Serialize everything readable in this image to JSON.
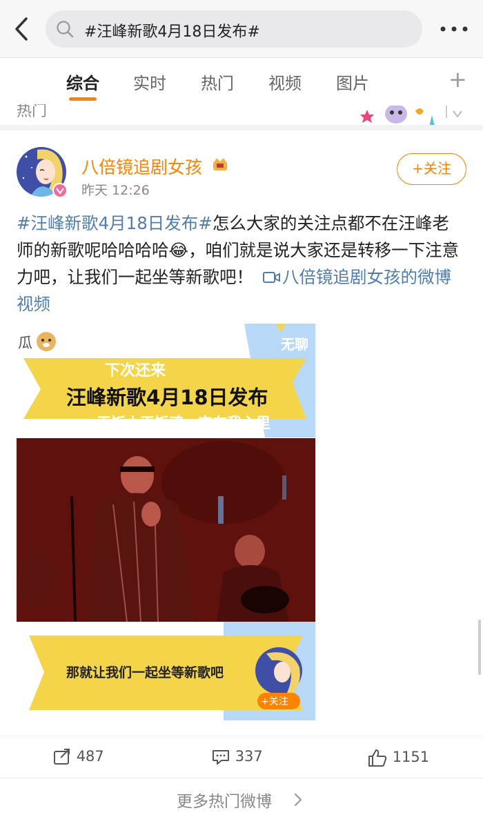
{
  "search": {
    "query": "#汪峰新歌4月18日发布#"
  },
  "tabs": [
    {
      "label": "综合"
    },
    {
      "label": "实时"
    },
    {
      "label": "热门"
    },
    {
      "label": "视频"
    },
    {
      "label": "图片"
    }
  ],
  "strip": {
    "label": "热门"
  },
  "post": {
    "author": "八倍镜追剧女孩",
    "time": "昨天 12:26",
    "follow_label": "+关注",
    "hashtag": "#汪峰新歌4月18日发布#",
    "text": "怎么大家的关注点都不在汪峰老师的新歌呢哈哈哈哈",
    "text2": "，咱们就是说大家还是转移一下注意力吧，让我们一起坐等新歌吧！",
    "video_link": "八倍镜追剧女孩的微博视频",
    "media": {
      "left_top": "瓜",
      "right_top": "无聊",
      "line1": "下次还来",
      "banner_title": "汪峰新歌4月18日发布",
      "line3": "干饭人干饭魂，宝在我心里",
      "bottom_banner": "那就让我们一起坐等新歌吧",
      "follow_small": "+关注"
    },
    "reposts": "487",
    "comments": "337",
    "likes": "1151"
  },
  "more_link": "更多热门微博",
  "colors": {
    "accent": "#ff8200",
    "link": "#507daf"
  }
}
